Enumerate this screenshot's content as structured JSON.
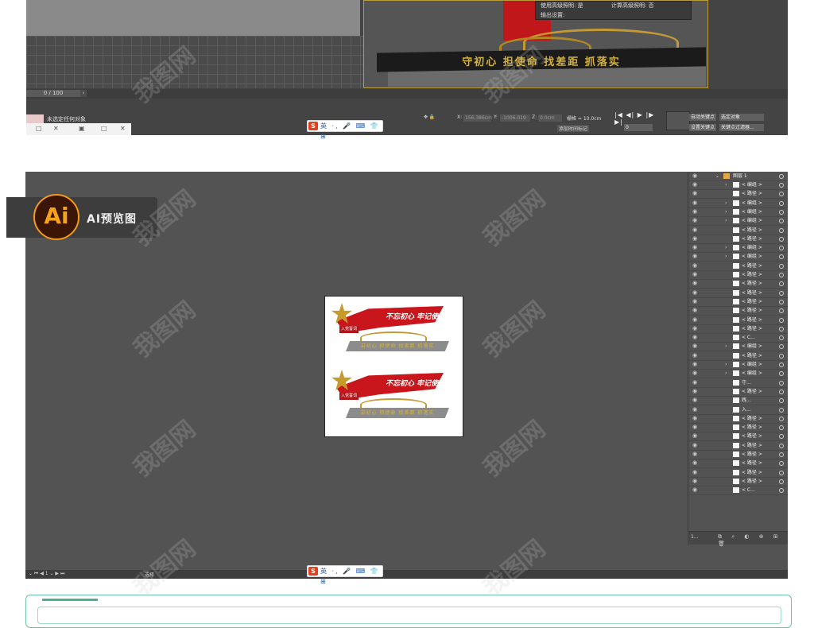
{
  "max": {
    "dialog_line1": "使用高级照明: 是",
    "dialog_line2": "计算高级照明: 否",
    "dialog_line3": "输出设置:",
    "render_slogan": "守初心 担使命 找差距 抓落实",
    "frame_counter": "0 / 100",
    "selection_status": "未选定任何对象",
    "coord_x_label": "X:",
    "coord_x_value": "156.386cm",
    "coord_y_label": "Y:",
    "coord_y_value": "-1006.019",
    "coord_z_label": "Z:",
    "coord_z_value": "0.0cm",
    "grid_label": "栅格 = 10.0cm",
    "add_time_tag": "添加时间标记",
    "frame_input": "0",
    "auto_key": "自动关键点",
    "set_key": "设置关键点",
    "selected_objects": "选定对象",
    "key_filters": "关键点过滤器...",
    "play_controls": "|◀ ◀| ▶ |▶ ▶|"
  },
  "ime": {
    "icon": "S",
    "text": "英 ·, 🎤 ⌨ 👕 ⊞"
  },
  "badge": {
    "logo": "Ai",
    "text": "AI预览图"
  },
  "artwork": {
    "title": "不忘初心 牢记使命",
    "label": "入党誓词",
    "slogan": "讲初心 担使命 找差距 抓落实"
  },
  "layers": {
    "top_layer": "图层 1",
    "items": [
      {
        "name": "< 编组 >",
        "arrow": "›"
      },
      {
        "name": "< 路径 >",
        "arrow": ""
      },
      {
        "name": "< 编组 >",
        "arrow": "›"
      },
      {
        "name": "< 编组 >",
        "arrow": "›"
      },
      {
        "name": "< 编组 >",
        "arrow": "›"
      },
      {
        "name": "< 路径 >",
        "arrow": ""
      },
      {
        "name": "< 路径 >",
        "arrow": ""
      },
      {
        "name": "< 编组 >",
        "arrow": "›"
      },
      {
        "name": "< 编组 >",
        "arrow": "›"
      },
      {
        "name": "< 路径 >",
        "arrow": ""
      },
      {
        "name": "< 路径 >",
        "arrow": ""
      },
      {
        "name": "< 路径 >",
        "arrow": ""
      },
      {
        "name": "< 路径 >",
        "arrow": ""
      },
      {
        "name": "< 路径 >",
        "arrow": ""
      },
      {
        "name": "< 路径 >",
        "arrow": ""
      },
      {
        "name": "< 路径 >",
        "arrow": ""
      },
      {
        "name": "< 路径 >",
        "arrow": ""
      },
      {
        "name": "< C...",
        "arrow": ""
      },
      {
        "name": "< 编组 >",
        "arrow": "›"
      },
      {
        "name": "< 路径 >",
        "arrow": ""
      },
      {
        "name": "< 编组 >",
        "arrow": "›"
      },
      {
        "name": "< 编组 >",
        "arrow": "›"
      },
      {
        "name": "守...",
        "arrow": ""
      },
      {
        "name": "< 路径 >",
        "arrow": ""
      },
      {
        "name": "践...",
        "arrow": ""
      },
      {
        "name": "入...",
        "arrow": ""
      },
      {
        "name": "< 路径 >",
        "arrow": ""
      },
      {
        "name": "< 路径 >",
        "arrow": ""
      },
      {
        "name": "< 路径 >",
        "arrow": ""
      },
      {
        "name": "< 路径 >",
        "arrow": ""
      },
      {
        "name": "< 路径 >",
        "arrow": ""
      },
      {
        "name": "< 路径 >",
        "arrow": ""
      },
      {
        "name": "< 路径 >",
        "arrow": ""
      },
      {
        "name": "< 路径 >",
        "arrow": ""
      },
      {
        "name": "< C...",
        "arrow": ""
      }
    ],
    "count": "1..."
  },
  "ai_status": {
    "selection": "选择"
  },
  "watermark": "我图网"
}
